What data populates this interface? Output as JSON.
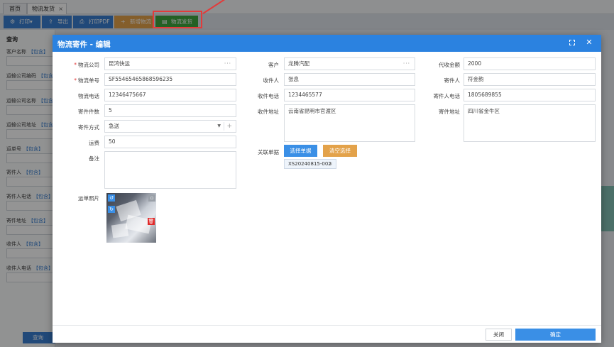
{
  "tabs": {
    "home": "首页",
    "active": "物流发货",
    "close": "×"
  },
  "toolbar": {
    "print": "打印",
    "print_caret": "▾",
    "export": "导出",
    "print_pdf": "打印PDF",
    "new_logistics": "新增物流",
    "ship": "物流发货"
  },
  "left_panel": {
    "title": "查询",
    "tag": "【包含】",
    "fields": [
      "客户名称",
      "运输公司编码",
      "运输公司名称",
      "运输公司地址",
      "运单号",
      "寄件人",
      "寄件人电话",
      "寄件地址",
      "收件人",
      "收件人电话"
    ],
    "query": "查询"
  },
  "modal": {
    "title": "物流寄件 - 编辑",
    "col1": {
      "company_label": "物流公司",
      "company": "昆鸿快运",
      "tracking_label": "物流单号",
      "tracking": "SF55465465868596235",
      "phone_label": "物流电话",
      "phone": "12346475667",
      "count_label": "寄件件数",
      "count": "5",
      "method_label": "寄件方式",
      "method": "急送",
      "fee_label": "运费",
      "fee": "50",
      "remark_label": "备注",
      "remark": "",
      "photo_label": "运单照片"
    },
    "col2": {
      "customer_label": "客户",
      "customer": "龙腾汽配",
      "receiver_label": "收件人",
      "receiver": "张息",
      "receiver_phone_label": "收件电话",
      "receiver_phone": "1234465577",
      "receiver_addr_label": "收件地址",
      "receiver_addr": "云南省昆明市官渡区",
      "linked_label": "关联单据",
      "select_btn": "选择单据",
      "clear_btn": "清空选择",
      "linked_doc": "XS20240815-002"
    },
    "col3": {
      "cod_label": "代收金额",
      "cod": "2000",
      "sender_label": "寄件人",
      "sender": "符金韵",
      "sender_phone_label": "寄件人电话",
      "sender_phone": "1805689855",
      "sender_addr_label": "寄件地址",
      "sender_addr": "四川省金牛区"
    },
    "footer": {
      "close": "关闭",
      "ok": "确定"
    }
  },
  "glyphs": {
    "dots": "···",
    "caret": "▼",
    "plus": "+",
    "remove": "×"
  },
  "colors": {
    "primary": "#2b82e0",
    "warning": "#e3a24a",
    "success": "#3fa63f",
    "danger": "#e02a2a",
    "annotation": "#e23b3b"
  }
}
